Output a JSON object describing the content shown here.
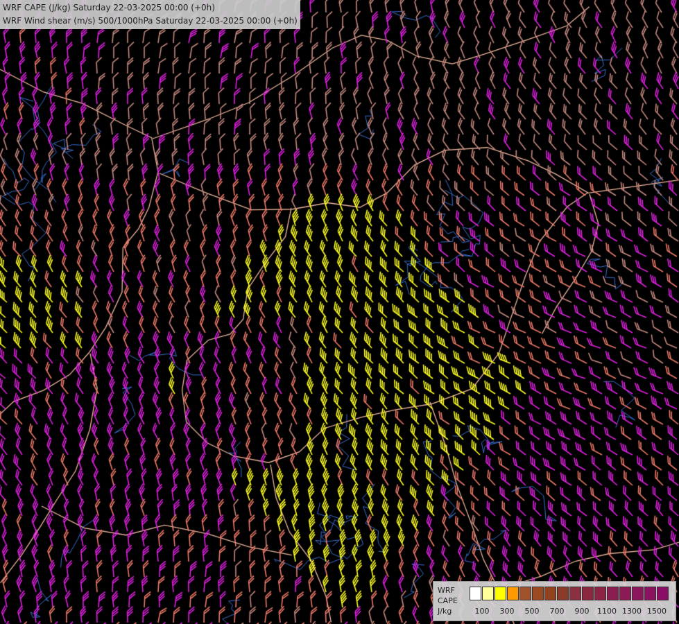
{
  "title": {
    "line1": "WRF CAPE (J/kg) Saturday 22-03-2025 00:00 (+0h)",
    "line2": "WRF Wind shear (m/s) 500/1000hPa Saturday 22-03-2025 00:00 (+0h)"
  },
  "legend": {
    "label_lines": [
      "WRF",
      "CAPE",
      "J/kg"
    ],
    "colors": [
      "#ffffff",
      "#ffff99",
      "#ffff00",
      "#ff9900",
      "#a0522d",
      "#9b4a24",
      "#934220",
      "#8b3a2a",
      "#8b3040",
      "#8b2840",
      "#8b2345",
      "#8b1e50",
      "#8b1a55",
      "#8b165a",
      "#8b1260",
      "#8b0e66"
    ],
    "ticks": [
      "100",
      "300",
      "500",
      "700",
      "900",
      "1100",
      "1300",
      "1500"
    ]
  },
  "barb_colors": {
    "low": "#c98a80",
    "salmon": "#f07a6a",
    "magenta": "#e020e0",
    "yellow": "#ffff20"
  },
  "colors": {
    "background": "#000000",
    "borders": "#f0b8a0",
    "rivers": "#3a6fd0"
  }
}
